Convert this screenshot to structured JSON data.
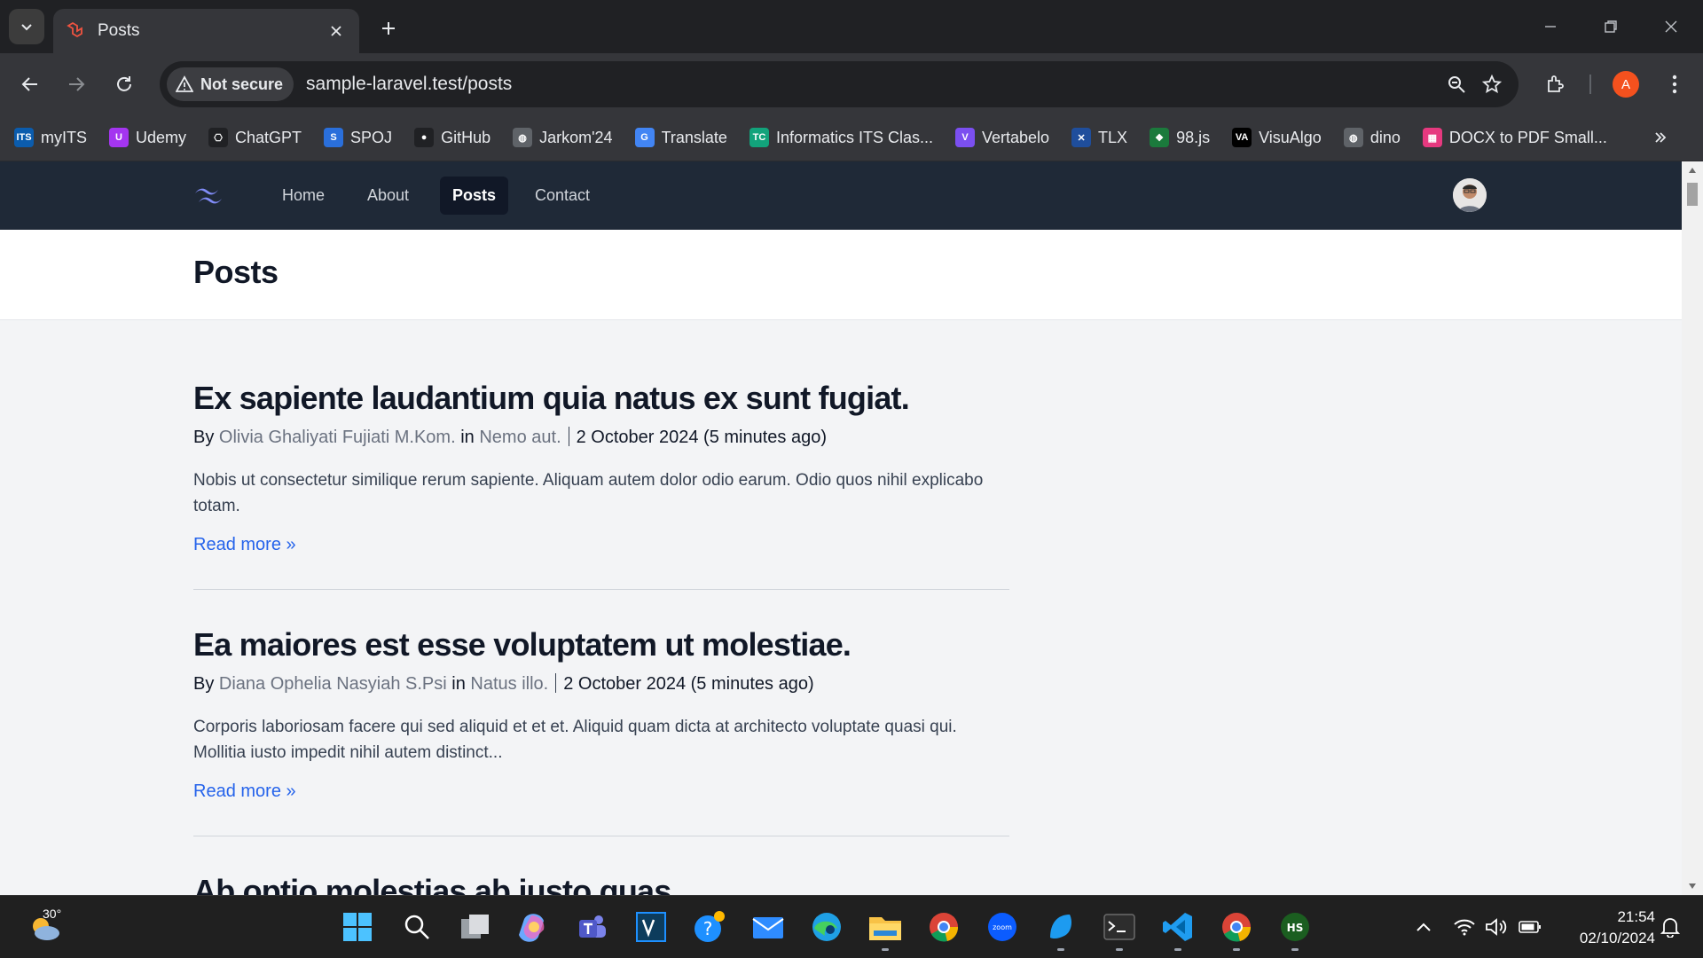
{
  "browser": {
    "tab_title": "Posts",
    "security_label": "Not secure",
    "url": "sample-laravel.test/posts",
    "profile_initial": "A",
    "bookmarks": [
      {
        "label": "myITS",
        "icon": "its-icon",
        "color": "#0b5cad",
        "glyph": "ITS"
      },
      {
        "label": "Udemy",
        "icon": "udemy-icon",
        "color": "#a435f0",
        "glyph": "U"
      },
      {
        "label": "ChatGPT",
        "icon": "chatgpt-icon",
        "color": "#202124",
        "glyph": "⎔"
      },
      {
        "label": "SPOJ",
        "icon": "spoj-icon",
        "color": "#2a6fdb",
        "glyph": "S"
      },
      {
        "label": "GitHub",
        "icon": "github-icon",
        "color": "#202124",
        "glyph": "●"
      },
      {
        "label": "Jarkom'24",
        "icon": "globe-icon",
        "color": "#5f6368",
        "glyph": "◍"
      },
      {
        "label": "Translate",
        "icon": "translate-icon",
        "color": "#4285f4",
        "glyph": "G"
      },
      {
        "label": "Informatics ITS Clas...",
        "icon": "tc-icon",
        "color": "#12a37b",
        "glyph": "TC"
      },
      {
        "label": "Vertabelo",
        "icon": "vertabelo-icon",
        "color": "#7b4ff0",
        "glyph": "V"
      },
      {
        "label": "TLX",
        "icon": "tlx-icon",
        "color": "#1f4e9c",
        "glyph": "✕"
      },
      {
        "label": "98.js",
        "icon": "windows98-icon",
        "color": "#1b7a3c",
        "glyph": "❖"
      },
      {
        "label": "VisuAlgo",
        "icon": "visualgo-icon",
        "color": "#000000",
        "glyph": "VA"
      },
      {
        "label": "dino",
        "icon": "globe-icon",
        "color": "#5f6368",
        "glyph": "◍"
      },
      {
        "label": "DOCX to PDF Small...",
        "icon": "smallpdf-icon",
        "color": "#e6397f",
        "glyph": "▦"
      }
    ]
  },
  "site": {
    "nav": [
      {
        "label": "Home",
        "active": false
      },
      {
        "label": "About",
        "active": false
      },
      {
        "label": "Posts",
        "active": true
      },
      {
        "label": "Contact",
        "active": false
      }
    ],
    "page_title": "Posts",
    "by_label": "By",
    "in_label": "in",
    "read_more": "Read more »",
    "posts": [
      {
        "title": "Ex sapiente laudantium quia natus ex sunt fugiat.",
        "author": "Olivia Ghaliyati Fujiati M.Kom.",
        "category": "Nemo aut.",
        "date": "2 October 2024 (5 minutes ago)",
        "excerpt": "Nobis ut consectetur similique rerum sapiente. Aliquam autem dolor odio earum. Odio quos nihil explicabo totam."
      },
      {
        "title": "Ea maiores est esse voluptatem ut molestiae.",
        "author": "Diana Ophelia Nasyiah S.Psi",
        "category": "Natus illo.",
        "date": "2 October 2024 (5 minutes ago)",
        "excerpt": "Corporis laboriosam facere qui sed aliquid et et et. Aliquid quam dicta at architecto voluptate quasi qui. Mollitia iusto impedit nihil autem distinct..."
      },
      {
        "title": "Ab optio molestias ab iusto quas.",
        "author": "",
        "category": "",
        "date": "",
        "excerpt": ""
      }
    ]
  },
  "taskbar": {
    "weather_temp": "30°",
    "time": "21:54",
    "date": "02/10/2024"
  },
  "colors": {
    "nav_bg": "#1f2937",
    "link_blue": "#2563eb",
    "muted_link": "#6b7280"
  }
}
